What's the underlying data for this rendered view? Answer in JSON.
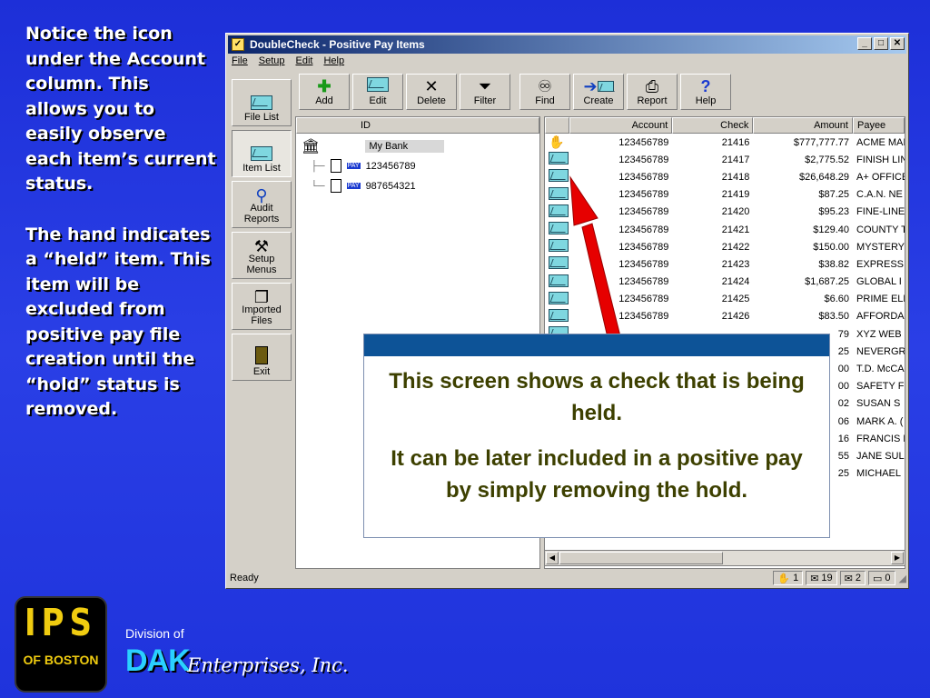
{
  "notes": {
    "para1": "Notice the icon under the Account column. This allows you to easily observe each item’s current status.",
    "para2": "The hand indicates a “held” item. This item will be excluded from positive pay file creation until the “hold” status is removed."
  },
  "window": {
    "title": "DoubleCheck - Positive Pay Items",
    "menu": [
      "File",
      "Setup",
      "Edit",
      "Help"
    ],
    "toolbar": [
      "Add",
      "Edit",
      "Delete",
      "Filter",
      "Find",
      "Create",
      "Report",
      "Help"
    ],
    "left_nav": [
      "File List",
      "Item List",
      "Audit Reports",
      "Setup Menus",
      "Imported Files",
      "Exit"
    ],
    "tree": {
      "column": "ID",
      "bank": "My Bank",
      "accounts": [
        "123456789",
        "987654321"
      ],
      "badge": "PAY"
    },
    "grid": {
      "columns": [
        "Account",
        "Check",
        "Amount",
        "Payee"
      ],
      "rows": [
        {
          "account": "123456789",
          "check": "21416",
          "amount": "$777,777.77",
          "payee": "ACME MAI",
          "status": "held"
        },
        {
          "account": "123456789",
          "check": "21417",
          "amount": "$2,775.52",
          "payee": "FINISH LIN",
          "status": "normal"
        },
        {
          "account": "123456789",
          "check": "21418",
          "amount": "$26,648.29",
          "payee": "A+ OFFICE",
          "status": "normal"
        },
        {
          "account": "123456789",
          "check": "21419",
          "amount": "$87.25",
          "payee": "C.A.N. NE",
          "status": "normal"
        },
        {
          "account": "123456789",
          "check": "21420",
          "amount": "$95.23",
          "payee": "FINE-LINE",
          "status": "normal"
        },
        {
          "account": "123456789",
          "check": "21421",
          "amount": "$129.40",
          "payee": "COUNTY T",
          "status": "normal"
        },
        {
          "account": "123456789",
          "check": "21422",
          "amount": "$150.00",
          "payee": "MYSTERY",
          "status": "normal"
        },
        {
          "account": "123456789",
          "check": "21423",
          "amount": "$38.82",
          "payee": "EXPRESS",
          "status": "normal"
        },
        {
          "account": "123456789",
          "check": "21424",
          "amount": "$1,687.25",
          "payee": "GLOBAL I",
          "status": "normal"
        },
        {
          "account": "123456789",
          "check": "21425",
          "amount": "$6.60",
          "payee": "PRIME ELE",
          "status": "normal"
        },
        {
          "account": "123456789",
          "check": "21426",
          "amount": "$83.50",
          "payee": "AFFORDA",
          "status": "normal"
        },
        {
          "account": "",
          "check": "",
          "amount": "79",
          "payee": "XYZ WEB",
          "status": "normal"
        },
        {
          "account": "",
          "check": "",
          "amount": "25",
          "payee": "NEVERGR",
          "status": "normal"
        },
        {
          "account": "",
          "check": "",
          "amount": "00",
          "payee": "T.D. McCA",
          "status": "normal"
        },
        {
          "account": "",
          "check": "",
          "amount": "00",
          "payee": "SAFETY F",
          "status": "normal"
        },
        {
          "account": "",
          "check": "",
          "amount": "02",
          "payee": "SUSAN S",
          "status": "normal"
        },
        {
          "account": "",
          "check": "",
          "amount": "06",
          "payee": "MARK A. (",
          "status": "normal"
        },
        {
          "account": "",
          "check": "",
          "amount": "16",
          "payee": "FRANCIS F",
          "status": "normal"
        },
        {
          "account": "",
          "check": "",
          "amount": "55",
          "payee": "JANE SUL",
          "status": "normal"
        },
        {
          "account": "",
          "check": "",
          "amount": "25",
          "payee": "MICHAEL",
          "status": "normal"
        }
      ]
    },
    "status": {
      "text": "Ready",
      "held_count": "1",
      "open_count": "19",
      "closed_count": "2",
      "other_count": "0"
    }
  },
  "popup": {
    "line1": "This screen shows a check that is being held.",
    "line2": "It can be later included in a positive pay by simply removing the hold."
  },
  "branding": {
    "logo_top": "IPS",
    "logo_bottom": "OF BOSTON",
    "division": "Division of",
    "dak": "DAK",
    "enterprises": "Enterprises, Inc."
  },
  "colors": {
    "background": "#2a3fe6",
    "arrow": "#e60000",
    "popup_bar": "#0d5397",
    "popup_text": "#3d4000"
  }
}
